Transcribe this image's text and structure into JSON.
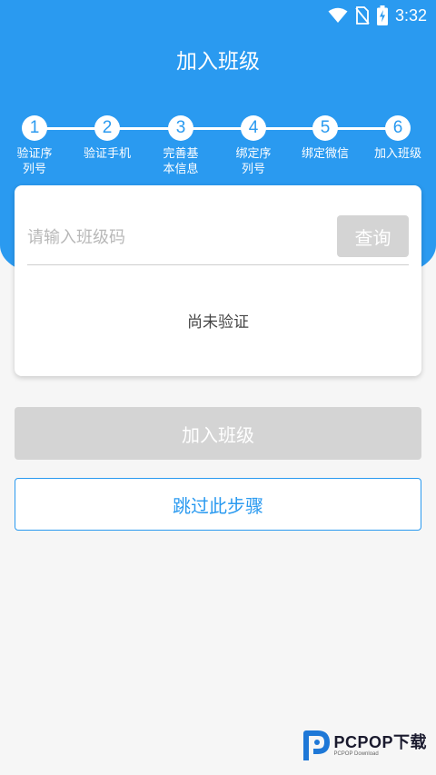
{
  "status_bar": {
    "time": "3:32",
    "icons": [
      "wifi-icon",
      "no-sim-icon",
      "battery-charging-icon"
    ]
  },
  "header": {
    "title": "加入班级"
  },
  "stepper": {
    "steps": [
      {
        "number": "1",
        "label": "验证序列号"
      },
      {
        "number": "2",
        "label": "验证手机"
      },
      {
        "number": "3",
        "label": "完善基本信息"
      },
      {
        "number": "4",
        "label": "绑定序列号"
      },
      {
        "number": "5",
        "label": "绑定微信"
      },
      {
        "number": "6",
        "label": "加入班级"
      }
    ]
  },
  "card": {
    "input_placeholder": "请输入班级码",
    "input_value": "",
    "query_label": "查询",
    "status_text": "尚未验证"
  },
  "actions": {
    "join_label": "加入班级",
    "skip_label": "跳过此步骤"
  },
  "watermark": {
    "brand": "PCPOP下载",
    "sub": "PCPOP Download"
  },
  "colors": {
    "primary": "#2a9af0",
    "disabled": "#d4d4d4",
    "background": "#f6f6f6"
  }
}
